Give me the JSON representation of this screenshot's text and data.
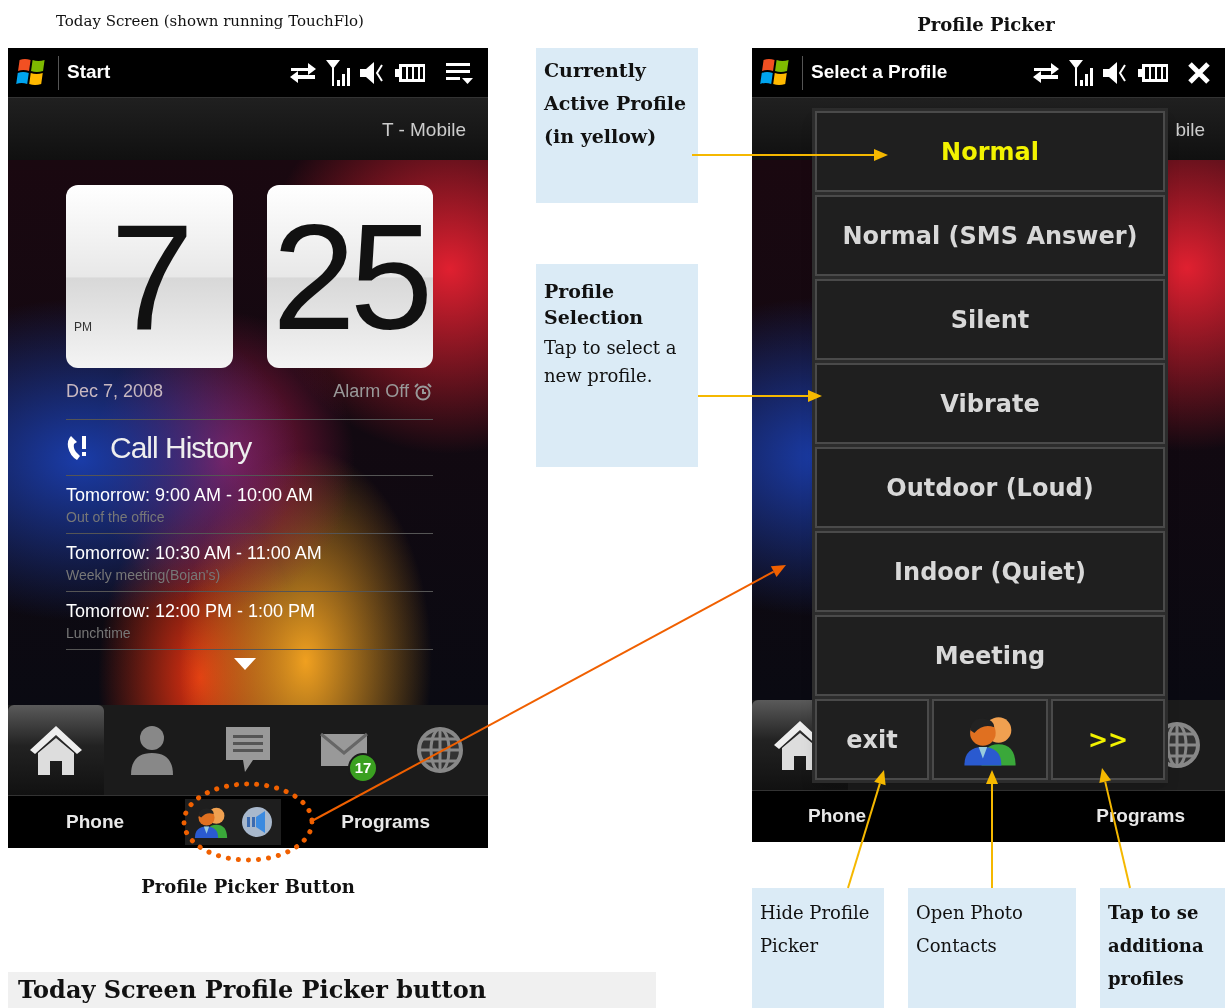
{
  "captions": {
    "left_title": "Today Screen (shown running TouchFlo)",
    "right_title": "Profile Picker",
    "button_caption": "Profile Picker Button"
  },
  "today_screen": {
    "title": "Start",
    "carrier": "T - Mobile",
    "clock": {
      "hour": "7",
      "minute": "25",
      "ampm": "PM"
    },
    "date": "Dec 7, 2008",
    "alarm": "Alarm Off",
    "section_title": "Call History",
    "appointments": [
      {
        "time": "Tomorrow: 9:00 AM - 10:00 AM",
        "subject": "Out of the office"
      },
      {
        "time": "Tomorrow: 10:30 AM - 11:00 AM",
        "subject": "Weekly meeting(Bojan's)"
      },
      {
        "time": "Tomorrow: 12:00 PM - 1:00 PM",
        "subject": "Lunchtime"
      }
    ],
    "tabs": [
      {
        "kind": "home",
        "selected": true
      },
      {
        "kind": "people",
        "selected": false
      },
      {
        "kind": "messages",
        "selected": false
      },
      {
        "kind": "mail",
        "selected": false,
        "badge": "17"
      },
      {
        "kind": "internet",
        "selected": false
      }
    ],
    "softkeys": {
      "left": "Phone",
      "right": "Programs"
    }
  },
  "profile_picker": {
    "title": "Select a Profile",
    "carrier": "bile",
    "profiles": [
      {
        "label": "Normal",
        "selected": true
      },
      {
        "label": "Normal (SMS Answer)",
        "selected": false
      },
      {
        "label": "Silent",
        "selected": false
      },
      {
        "label": "Vibrate",
        "selected": false
      },
      {
        "label": "Outdoor (Loud)",
        "selected": false
      },
      {
        "label": "Indoor (Quiet)",
        "selected": false
      },
      {
        "label": "Meeting",
        "selected": false
      }
    ],
    "exit_label": "exit",
    "more_label": ">>",
    "tabs": [
      {
        "kind": "home",
        "selected": true
      },
      {
        "kind": "internet",
        "selected": false
      }
    ],
    "softkeys": {
      "left": "Phone",
      "right": "Programs"
    }
  },
  "callouts": [
    {
      "kind": "bold",
      "text": "Currently Active Profile (in yellow)"
    },
    {
      "kind": "titled",
      "title": "Profile Selection",
      "text": "Tap to select a new profile."
    },
    {
      "kind": "plain",
      "text": "Hide Profile Picker"
    },
    {
      "kind": "plain",
      "text": "Open Photo Contacts"
    },
    {
      "kind": "bold",
      "text": "Tap to se\nadditiona\nprofiles"
    }
  ],
  "footer_heading": "Today Screen Profile Picker button"
}
